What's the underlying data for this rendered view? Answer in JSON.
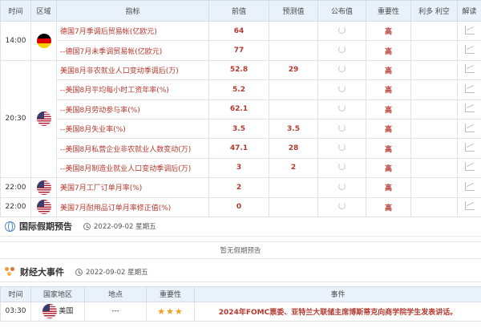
{
  "calendar": {
    "headers": [
      "时间",
      "区域",
      "指标",
      "前值",
      "预测值",
      "公布值",
      "重要性",
      "利多 利空",
      "解读"
    ],
    "rows": [
      {
        "time": "14:00",
        "flag": "de",
        "indicator": "德国7月季调后贸易帐(亿欧元)",
        "prev": "64",
        "forecast": "",
        "importance": "高"
      },
      {
        "time": "",
        "flag": "",
        "indicator": "--德国7月未季调贸易帐(亿欧元)",
        "prev": "77",
        "forecast": "",
        "importance": "高"
      },
      {
        "time": "",
        "flag": "",
        "indicator": "美国8月非农就业人口变动季调后(万)",
        "prev": "52.8",
        "forecast": "29",
        "importance": "高"
      },
      {
        "time": "",
        "flag": "",
        "indicator": "--美国8月平均每小时工资年率(%)",
        "prev": "5.2",
        "forecast": "",
        "importance": "高"
      },
      {
        "time": "20:30",
        "flag": "us",
        "indicator": "--美国8月劳动参与率(%)",
        "prev": "62.1",
        "forecast": "",
        "importance": "高"
      },
      {
        "time": "",
        "flag": "",
        "indicator": "--美国8月失业率(%)",
        "prev": "3.5",
        "forecast": "3.5",
        "importance": "高"
      },
      {
        "time": "",
        "flag": "",
        "indicator": "--美国8月私营企业非农就业人数变动(万)",
        "prev": "47.1",
        "forecast": "28",
        "importance": "高"
      },
      {
        "time": "",
        "flag": "",
        "indicator": "--美国8月制造业就业人口变动季调后(万)",
        "prev": "3",
        "forecast": "2",
        "importance": "高"
      },
      {
        "time": "22:00",
        "flag": "us",
        "indicator": "美国7月工厂订单月率(%)",
        "prev": "2",
        "forecast": "",
        "importance": "高"
      },
      {
        "time": "22:00",
        "flag": "us",
        "indicator": "美国7月耐用品订单月率修正值(%)",
        "prev": "0",
        "forecast": "",
        "importance": "高"
      }
    ]
  },
  "holiday": {
    "title": "国际假期预告",
    "date": "2022-09-02 星期五",
    "notice": "暂无假期预告"
  },
  "events": {
    "title": "财经大事件",
    "date": "2022-09-02 星期五",
    "headers": [
      "时间",
      "国家地区",
      "地点",
      "重要性",
      "事件"
    ],
    "rows": [
      {
        "time": "03:30",
        "country": "美国",
        "place": "---",
        "stars": "★★★",
        "event": "2024年FOMC票委、亚特兰大联储主席博斯蒂克向商学院学生发表讲话。"
      }
    ]
  },
  "colors": {
    "accent_red": "#b5382e",
    "header_bg": "#e9f1fb",
    "star": "#f0a21c"
  }
}
